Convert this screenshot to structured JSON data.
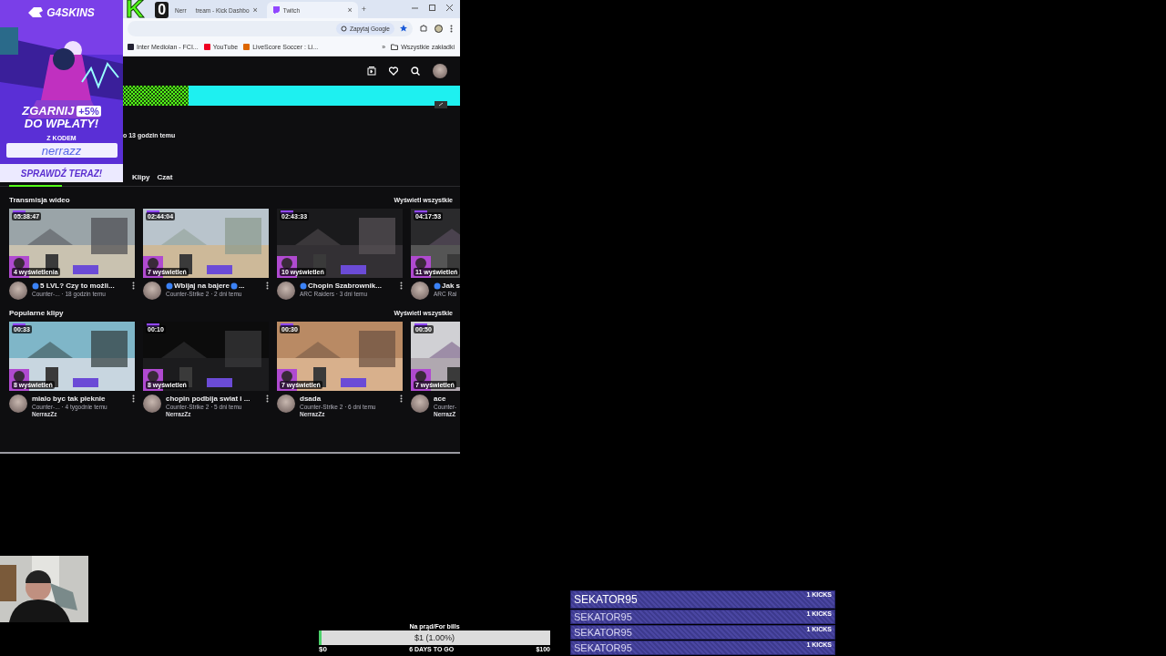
{
  "overlay_logo": {
    "letter": "K",
    "count": "0"
  },
  "browser": {
    "tabs": [
      {
        "title_parts": [
          "Nerr",
          "tream - Kick Dashbo"
        ],
        "close": "×",
        "selected": false
      },
      {
        "title_parts": [
          "Twitch"
        ],
        "close": "×",
        "selected": true
      }
    ],
    "new_tab": "+",
    "ask_chip": "Zapytaj Google",
    "bookmarks": [
      "Inter Mediolan - FCI...",
      "YouTube",
      "LiveScore Soccer : Li..."
    ],
    "bookmarks_more": "»",
    "all_bookmarks": "Wszystkie zakładki"
  },
  "page": {
    "channel_info": "o 13 godzin temu",
    "tabs": [
      {
        "label": "Klipy",
        "selected": false
      },
      {
        "label": "Czat",
        "selected": false
      }
    ],
    "sections": [
      {
        "title": "Transmisja wideo",
        "view_all": "Wyświetl wszystkie",
        "items": [
          {
            "duration": "05:38:47",
            "views": "4 wyświetlenia",
            "title": [
              {
                "kind": "dot"
              },
              {
                "kind": "text",
                "text": "5 LVL? Czy to możli..."
              }
            ],
            "meta": "Counter-... · 18 godzin temu",
            "more_button": true
          },
          {
            "duration": "02:44:04",
            "views": "7 wyświetleń",
            "title": [
              {
                "kind": "dot"
              },
              {
                "kind": "text",
                "text": "Wbijaj na bajere"
              },
              {
                "kind": "dot"
              },
              {
                "kind": "text",
                "text": "..."
              }
            ],
            "meta": "Counter-Strike 2 · 2 dni temu",
            "more_button": true
          },
          {
            "duration": "02:43:33",
            "views": "10 wyświetleń",
            "title": [
              {
                "kind": "dot"
              },
              {
                "kind": "text",
                "text": "Chopin Szabrownik..."
              }
            ],
            "meta": "ARC Raiders · 3 dni temu",
            "more_button": true
          },
          {
            "duration": "04:17:53",
            "views": "11 wyświetleń",
            "title": [
              {
                "kind": "dot"
              },
              {
                "kind": "text",
                "text": "Jak s"
              }
            ],
            "meta": "ARC Rai",
            "more_button": false
          }
        ]
      },
      {
        "title": "Popularne klipy",
        "view_all": "Wyświetl wszystkie",
        "items": [
          {
            "duration": "00:33",
            "views": "8 wyświetleń",
            "title": [
              {
                "kind": "text",
                "text": "mialo byc tak pieknie"
              }
            ],
            "meta": "Counter-... · 4 tygodnie temu",
            "channel": "NerrazZz",
            "more_button": true
          },
          {
            "duration": "00:10",
            "views": "8 wyświetleń",
            "title": [
              {
                "kind": "text",
                "text": "chopin podbija swiat i ..."
              }
            ],
            "meta": "Counter-Strike 2 · 5 dni temu",
            "channel": "NerrazZz",
            "more_button": true
          },
          {
            "duration": "00:30",
            "views": "7 wyświetleń",
            "title": [
              {
                "kind": "text",
                "text": "dsada"
              }
            ],
            "meta": "Counter-Strike 2 · 6 dni temu",
            "channel": "NerrazZz",
            "more_button": true
          },
          {
            "duration": "00:50",
            "views": "7 wyświetleń",
            "title": [
              {
                "kind": "text",
                "text": "ace"
              }
            ],
            "meta": "Counter-",
            "channel": "NerrazZ",
            "more_button": false
          }
        ]
      }
    ]
  },
  "ad": {
    "brand": "G4SKINS",
    "headline_1": "ZGARNIJ",
    "bonus": "+5%",
    "headline_2": "DO WPŁATY!",
    "code_label": "Z KODEM",
    "code": "nerrazz",
    "cta": "SPRAWDŹ TERAZ!"
  },
  "goal": {
    "title": "Na prąd/For bills",
    "level": 0.01,
    "amount": "$1 (1.00%)",
    "min": "$0",
    "remaining": "6 DAYS TO GO",
    "max": "$100"
  },
  "kicks": [
    {
      "kind": "top",
      "name": "SEKATOR95",
      "amount": "1 KICKS"
    },
    {
      "kind": "row",
      "name": "SEKATOR95",
      "amount": "1 KICKS"
    },
    {
      "kind": "row",
      "name": "SEKATOR95",
      "amount": "1 KICKS"
    },
    {
      "kind": "row",
      "name": "SEKATOR95",
      "amount": "1 KICKS"
    }
  ]
}
